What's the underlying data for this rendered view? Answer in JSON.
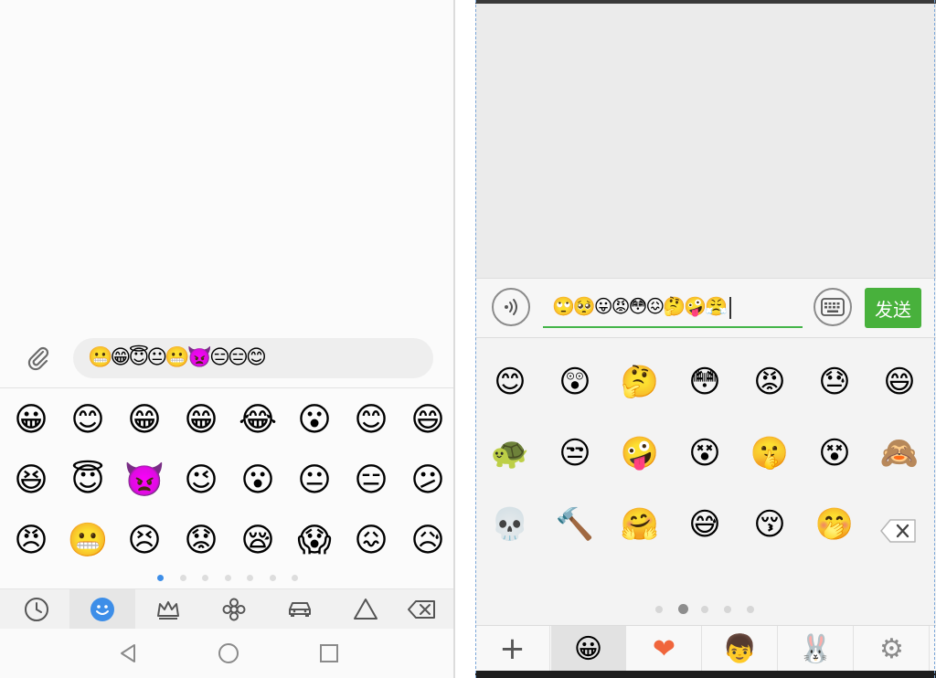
{
  "left": {
    "input": {
      "emojis": "😬😁😇😐😬👿😑😑😊"
    },
    "grid": [
      [
        "😀",
        "😊",
        "😁",
        "😁",
        "😂",
        "😮",
        "😊",
        "😄"
      ],
      [
        "😆",
        "😇",
        "👿",
        "😉",
        "😮",
        "😐",
        "😑",
        "😕"
      ],
      [
        "😠",
        "😬",
        "😣",
        "😟",
        "😪",
        "😱",
        "😖",
        "😥"
      ]
    ],
    "page_dots": {
      "count": 7,
      "active": 0
    },
    "tabs": [
      {
        "name": "recent-icon",
        "active": false
      },
      {
        "name": "smiley-icon",
        "active": true
      },
      {
        "name": "crown-icon",
        "active": false
      },
      {
        "name": "flower-icon",
        "active": false
      },
      {
        "name": "car-icon",
        "active": false
      },
      {
        "name": "triangle-icon",
        "active": false
      },
      {
        "name": "backspace-icon",
        "active": false
      }
    ],
    "colors": {
      "accent": "#3d8ee8"
    }
  },
  "right": {
    "input": {
      "emojis": "🙄🥺😛😡😳😖🤔🤪😤"
    },
    "send_label": "发送",
    "grid": [
      [
        "😊",
        "😲",
        "🤔",
        "😳",
        "😡",
        "😓",
        "😄"
      ],
      [
        "🐢",
        "😒",
        "🤪",
        "😵",
        "🤫",
        "😵",
        "🙈"
      ],
      [
        "💀",
        "🔨",
        "🤗",
        "😅",
        "😚",
        "🤭"
      ]
    ],
    "page_dots": {
      "count": 5,
      "active": 1
    },
    "tabs": [
      {
        "name": "add-icon",
        "glyph": "+"
      },
      {
        "name": "smiley-icon",
        "glyph": "😀"
      },
      {
        "name": "heart-icon",
        "glyph": "❤"
      },
      {
        "name": "avatar-sticker-icon",
        "glyph": "👦"
      },
      {
        "name": "rabbit-sticker-icon",
        "glyph": "🐰"
      },
      {
        "name": "settings-icon",
        "glyph": "⚙"
      }
    ],
    "colors": {
      "send": "#48b13c",
      "underline": "#44b549"
    }
  }
}
